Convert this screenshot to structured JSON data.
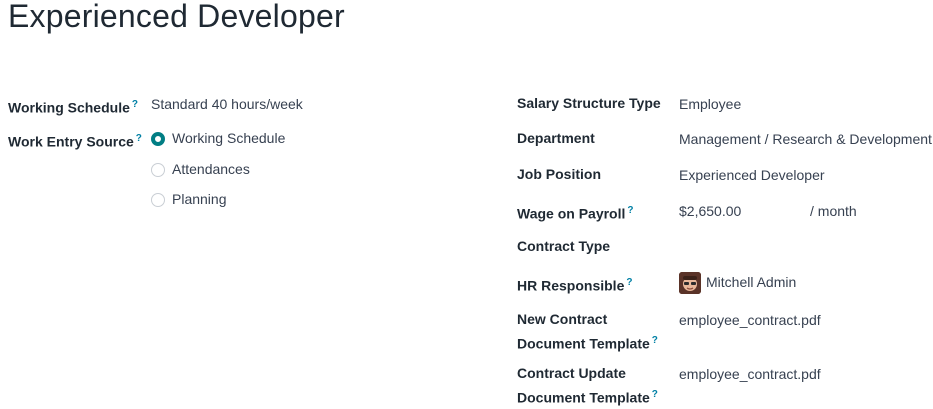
{
  "page_title": "Experienced Developer",
  "help_marker": "?",
  "left": {
    "working_schedule": {
      "label": "Working Schedule",
      "value": "Standard 40 hours/week"
    },
    "work_entry_source": {
      "label": "Work Entry Source",
      "options": [
        "Working Schedule",
        "Attendances",
        "Planning"
      ],
      "selected": "Working Schedule"
    }
  },
  "right": {
    "salary_structure_type": {
      "label": "Salary Structure Type",
      "value": "Employee"
    },
    "department": {
      "label": "Department",
      "value": "Management / Research & Development"
    },
    "job_position": {
      "label": "Job Position",
      "value": "Experienced Developer"
    },
    "wage_on_payroll": {
      "label": "Wage on Payroll",
      "value": "$2,650.00",
      "unit": "/ month"
    },
    "contract_type": {
      "label": "Contract Type",
      "value": ""
    },
    "hr_responsible": {
      "label": "HR Responsible",
      "value": "Mitchell Admin",
      "avatar_icon": "user-avatar-icon"
    },
    "new_contract_template": {
      "label": "New Contract Document Template",
      "value": "employee_contract.pdf"
    },
    "contract_update_template": {
      "label": "Contract Update Document Template",
      "value": "employee_contract.pdf"
    }
  },
  "colors": {
    "accent": "#017e84",
    "help": "#0180a5"
  }
}
